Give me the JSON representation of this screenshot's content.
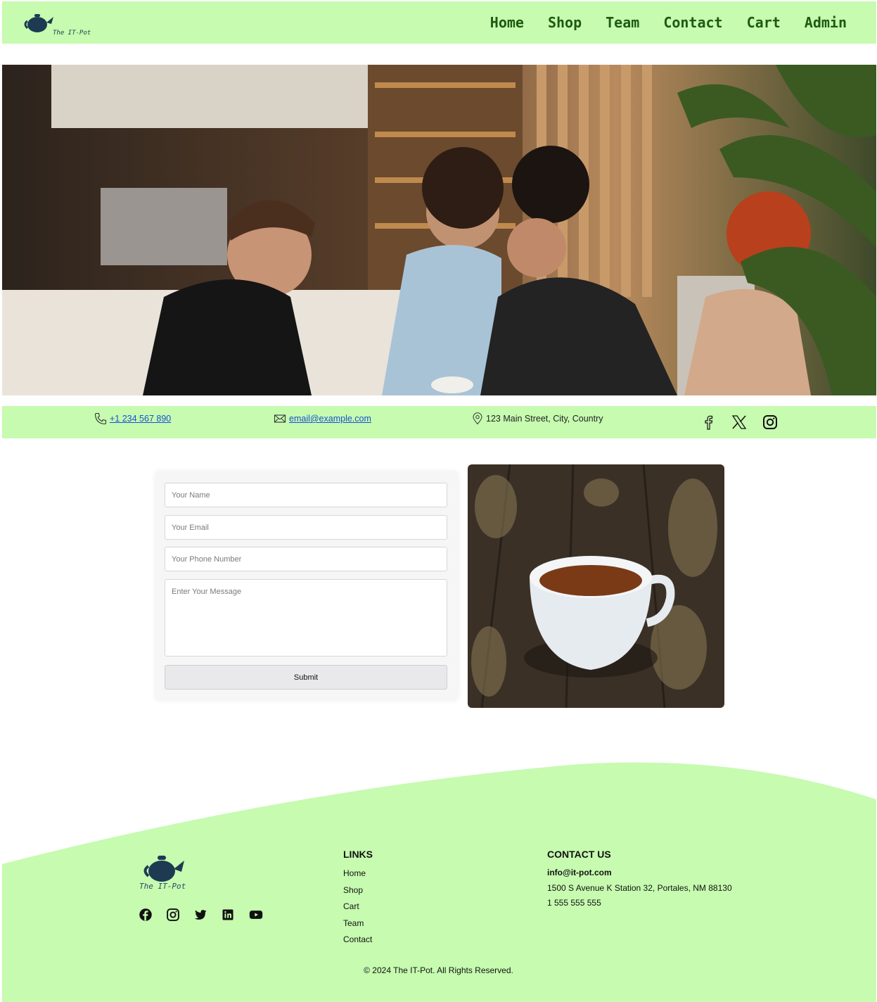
{
  "header": {
    "logo_text": "The IT-Pot",
    "nav": [
      "Home",
      "Shop",
      "Team",
      "Contact",
      "Cart",
      "Admin"
    ]
  },
  "contact_bar": {
    "phone": "+1 234 567 890",
    "email": "email@example.com",
    "address": "123 Main Street, City, Country",
    "socials": [
      "facebook-icon",
      "x-icon",
      "instagram-icon"
    ]
  },
  "form": {
    "name_placeholder": "Your Name",
    "email_placeholder": "Your Email",
    "phone_placeholder": "Your Phone Number",
    "message_placeholder": "Enter Your Message",
    "submit_label": "Submit"
  },
  "footer": {
    "logo_text": "The IT-Pot",
    "socials": [
      "facebook-icon",
      "instagram-icon",
      "twitter-icon",
      "linkedin-icon",
      "youtube-icon"
    ],
    "links_title": "LINKS",
    "links": [
      "Home",
      "Shop",
      "Cart",
      "Team",
      "Contact"
    ],
    "contact_title": "CONTACT US",
    "contact_email": "info@it-pot.com",
    "contact_address": "1500 S Avenue K Station 32, Portales, NM 88130",
    "contact_phone": "1 555 555 555",
    "copyright": "© 2024 The IT-Pot. All Rights Reserved."
  },
  "colors": {
    "accent_green": "#c6fbb0",
    "nav_text": "#1e5a12",
    "link_blue": "#1a4fd6"
  }
}
